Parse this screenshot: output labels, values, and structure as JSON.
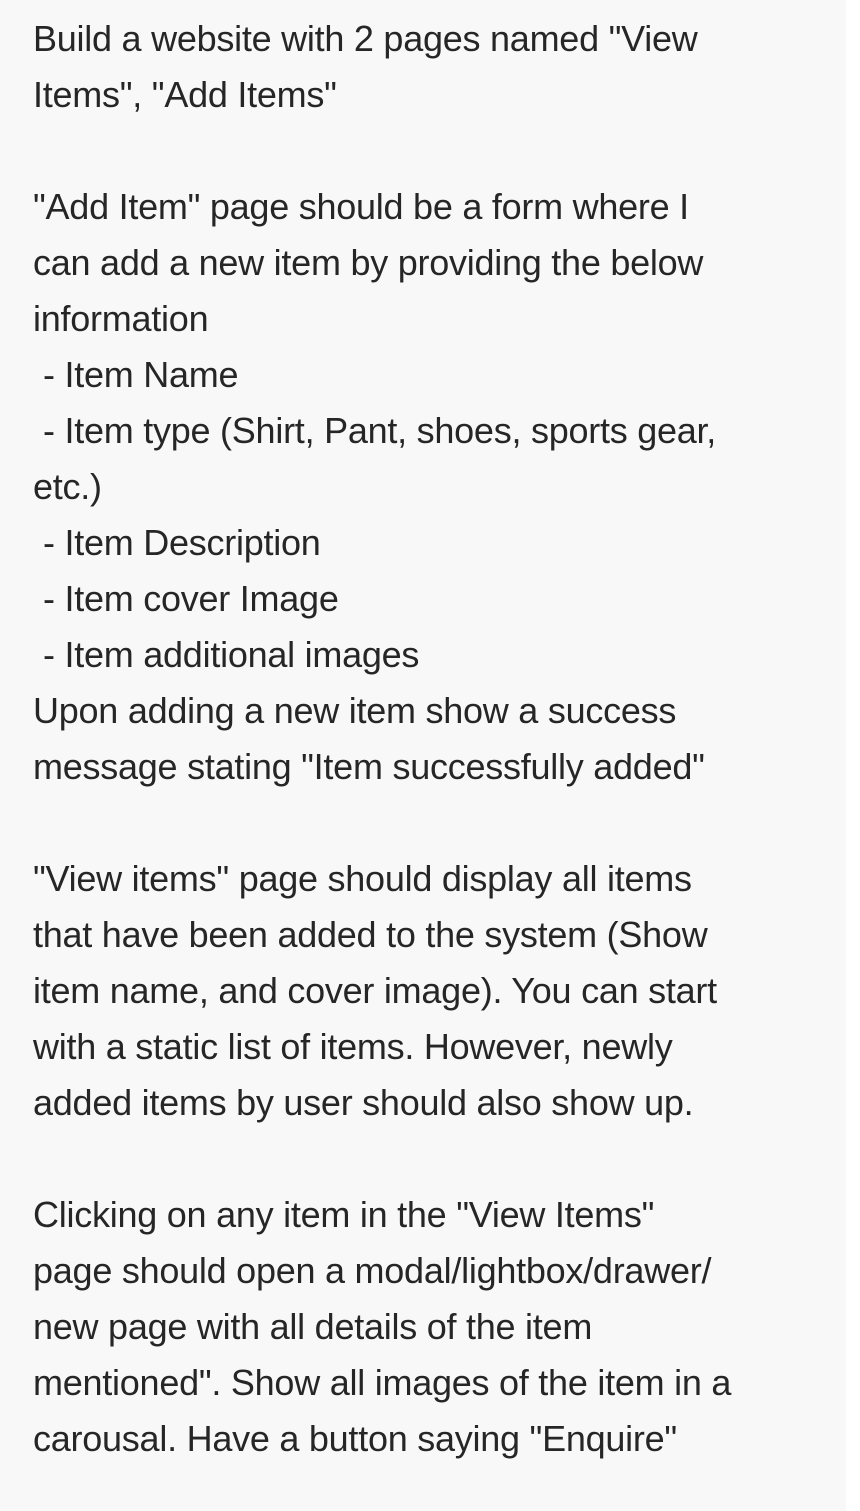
{
  "document": {
    "paragraphs": [
      {
        "lines": [
          "Build a website with 2 pages named \"View",
          "Items\", \"Add Items\""
        ]
      },
      {
        "lines": [
          "\"Add Item\" page should be a form where I",
          "can add a new item by providing the below",
          "information"
        ],
        "bullets": [
          "- Item Name",
          "- Item type (Shirt, Pant, shoes, sports gear,",
          "etc.)",
          "- Item Description",
          "- Item cover Image",
          "- Item additional images"
        ],
        "after": [
          "Upon adding a new item show a success",
          "message stating \"Item successfully added\""
        ]
      },
      {
        "lines": [
          "\"View items\" page should display all items",
          "that have been added to the system (Show",
          "item name, and cover image). You can start",
          "with a static list of items. However, newly",
          "added items by user should also show up."
        ]
      },
      {
        "lines": [
          "Clicking on any item in the \"View Items\"",
          "page should open a modal/lightbox/drawer/",
          "new page with all details of the item",
          "mentioned\". Show all images of the item in a",
          "carousal. Have a button saying \"Enquire\""
        ]
      }
    ]
  }
}
